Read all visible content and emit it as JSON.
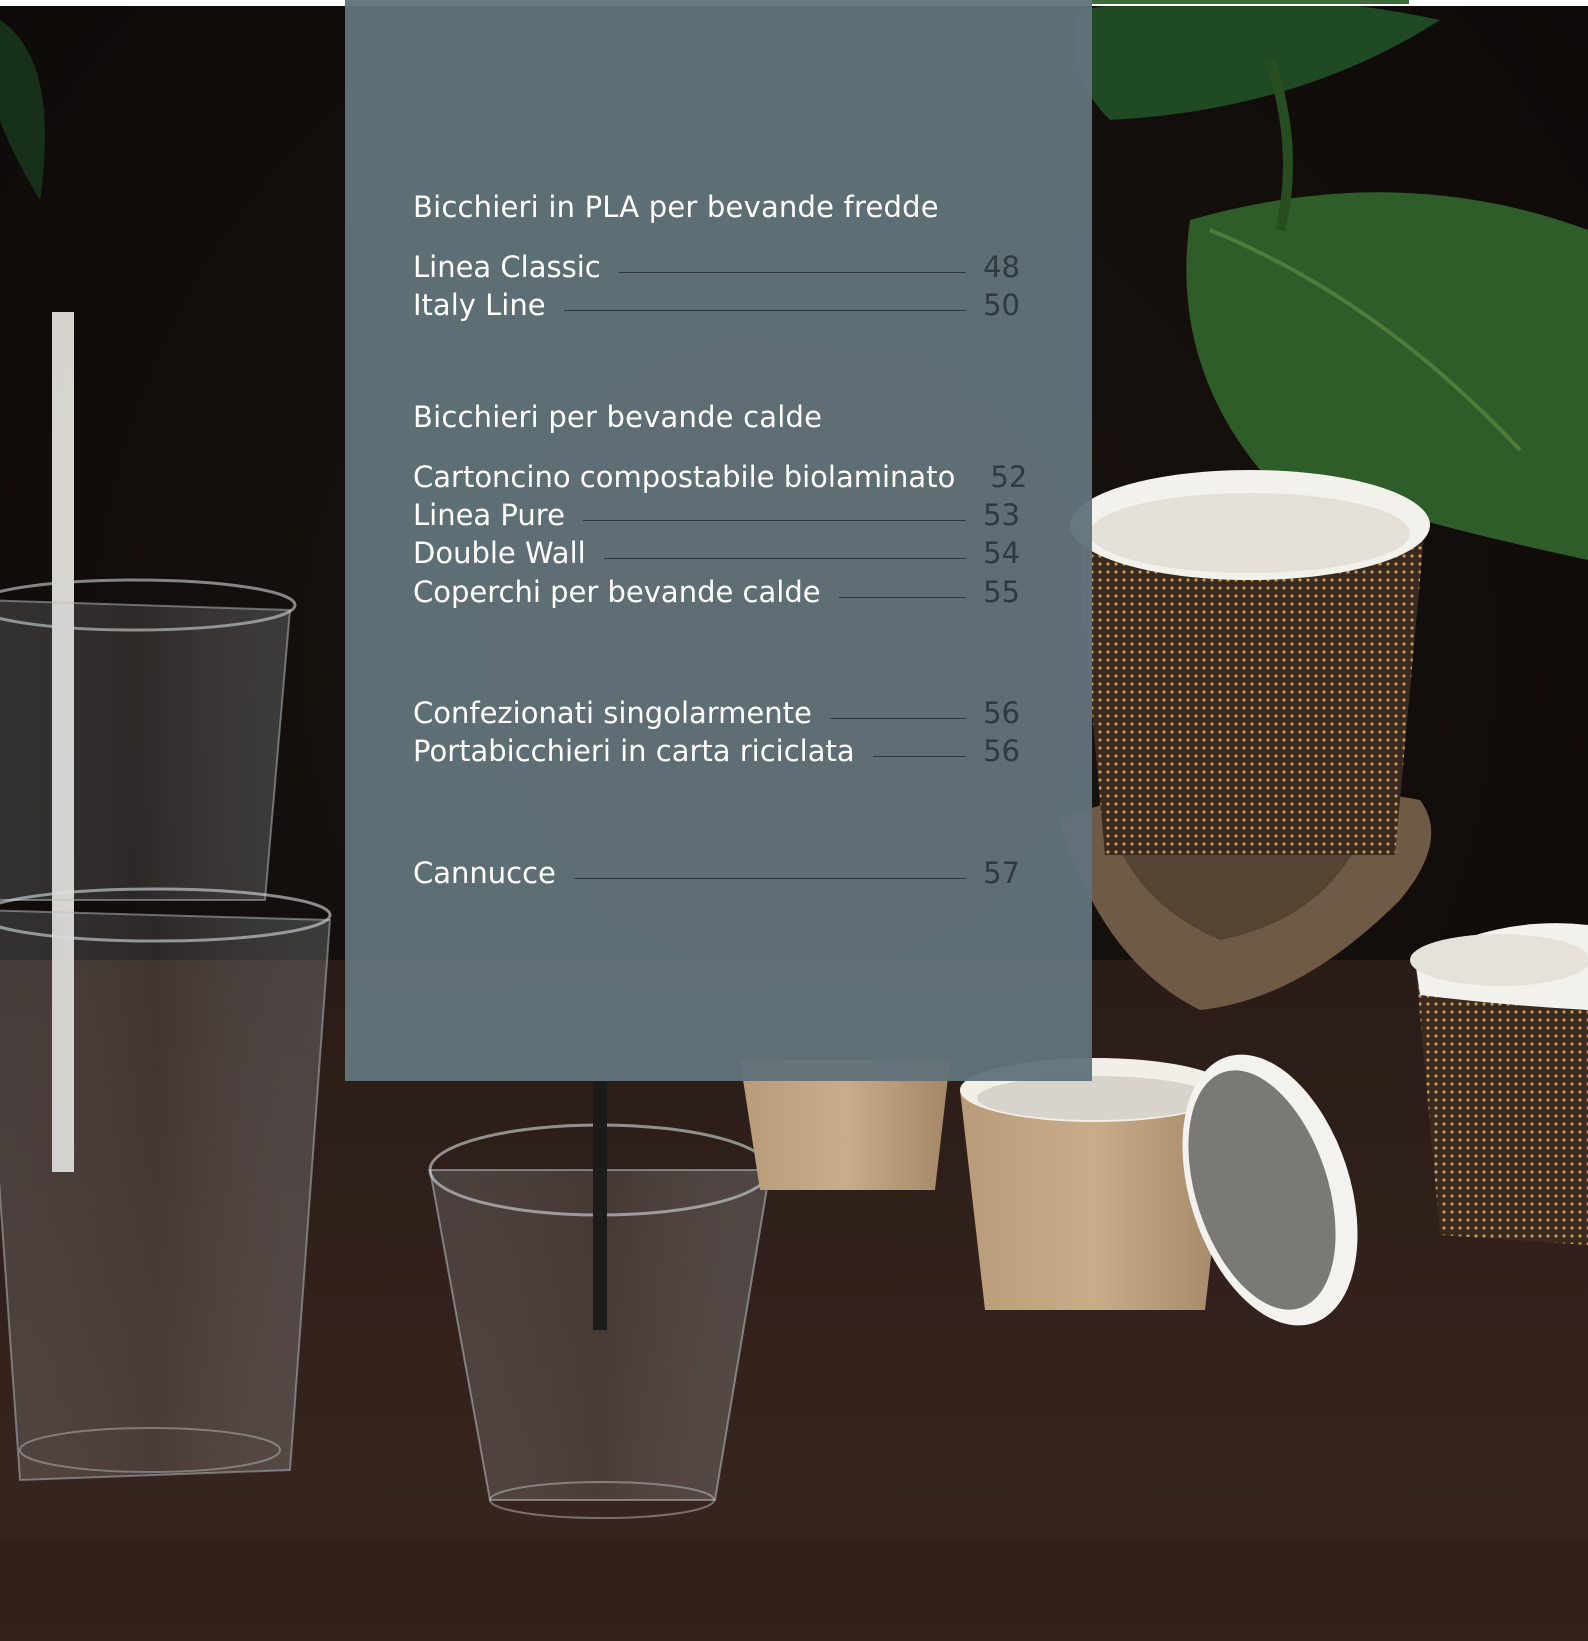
{
  "toc": {
    "sections": [
      {
        "title": "Bicchieri in PLA per bevande fredde",
        "entries": [
          {
            "label": "Linea Classic",
            "page": "48"
          },
          {
            "label": "Italy Line",
            "page": "50"
          }
        ]
      },
      {
        "title": "Bicchieri per bevande calde",
        "entries": [
          {
            "label": "Cartoncino compostabile biolaminato",
            "page": "52"
          },
          {
            "label": "Linea Pure",
            "page": "53"
          },
          {
            "label": "Double Wall",
            "page": "54"
          },
          {
            "label": "Coperchi per bevande calde",
            "page": "55"
          }
        ]
      },
      {
        "title": "",
        "entries": [
          {
            "label": "Confezionati singolarmente",
            "page": "56"
          },
          {
            "label": "Portabicchieri in carta riciclata",
            "page": "56"
          }
        ]
      },
      {
        "title": "",
        "entries": [
          {
            "label": "Cannucce",
            "page": "57"
          }
        ]
      }
    ]
  },
  "colors": {
    "panel": "#62727a",
    "text": "#ffffff",
    "page_number": "#2d3a40",
    "accent_green": "#3d6b3a"
  },
  "photo": {
    "subjects": [
      "plastic-cups-icon",
      "paper-cups-icon",
      "straw-icon",
      "cup-carrier-icon",
      "leaf-icon"
    ]
  }
}
